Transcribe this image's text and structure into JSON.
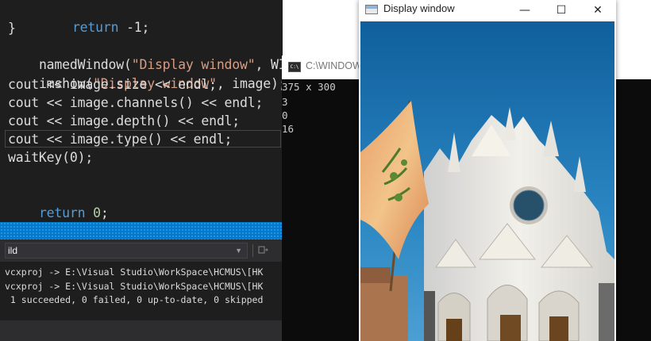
{
  "editor": {
    "lines": [
      {
        "kw": "return",
        "rest": " ",
        "num": "-1",
        "end": ";"
      },
      {
        "text": "}"
      },
      {
        "fn": "namedWindow(",
        "str": "\"Display window\"",
        "rest": ", WINDOW_AUTOSI"
      },
      {
        "fn": "imshow(",
        "str": "\"Display window\"",
        "rest": ", image); ",
        "cmt": "/"
      },
      {
        "text": "cout << image.size << endl;"
      },
      {
        "text": "cout << image.channels() << endl;"
      },
      {
        "text": "cout << image.depth() << endl;"
      },
      {
        "text": "cout << image.type() << endl;"
      },
      {
        "text": "waitKey(0);"
      },
      {
        "text": ""
      },
      {
        "kw": "return",
        "rest": " ",
        "num": "0",
        "end": ";"
      }
    ]
  },
  "output": {
    "source_label": "ild",
    "lines": [
      "vcxproj -> E:\\Visual Studio\\WorkSpace\\HCMUS\\[HK",
      "vcxproj -> E:\\Visual Studio\\WorkSpace\\HCMUS\\[HK",
      " 1 succeeded, 0 failed, 0 up-to-date, 0 skipped"
    ]
  },
  "console": {
    "title": "C:\\WINDOW",
    "icon_text": "C:\\",
    "lines": [
      "375 x 300",
      "3",
      "0",
      "16"
    ]
  },
  "display_window": {
    "title": "Display window",
    "minimize": "—",
    "maximize": "☐",
    "close": "✕"
  },
  "colors": {
    "editor_bg": "#1e1e1e",
    "keyword": "#569cd6",
    "string": "#d69d85",
    "accent_blue": "#007acc",
    "console_bg": "#0c0c0c"
  }
}
